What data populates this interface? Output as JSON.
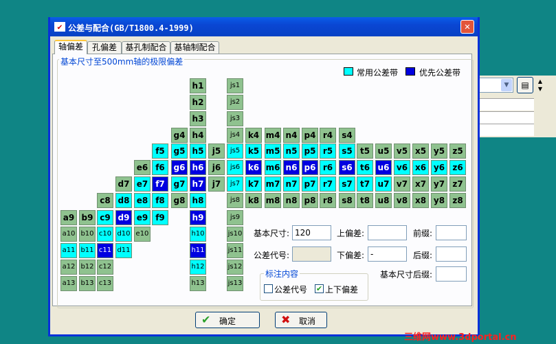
{
  "window": {
    "title": "公差与配合(GB/T1800.4-1999)",
    "close": "✕"
  },
  "tabs": [
    "轴偏差",
    "孔偏差",
    "基孔制配合",
    "基轴制配合"
  ],
  "group_title": "基本尺寸至500mm轴的极限偏差",
  "legend": {
    "common": "常用公差带",
    "preferred": "优先公差带",
    "common_color": "#00ffff",
    "preferred_color": "#0000e0"
  },
  "grid": [
    {
      "c": "a9",
      "s": "g"
    },
    {
      "c": "a10",
      "s": "g"
    },
    {
      "c": "a11",
      "s": "c"
    },
    {
      "c": "a12",
      "s": "g"
    },
    {
      "c": "a13",
      "s": "g"
    },
    {
      "c": "b9",
      "s": "g"
    },
    {
      "c": "b10",
      "s": "g"
    },
    {
      "c": "b11",
      "s": "c"
    },
    {
      "c": "b12",
      "s": "g"
    },
    {
      "c": "b13",
      "s": "g"
    },
    {
      "c": "c8",
      "s": "g"
    },
    {
      "c": "c9",
      "s": "c"
    },
    {
      "c": "c10",
      "s": "c"
    },
    {
      "c": "c11",
      "s": "b"
    },
    {
      "c": "c12",
      "s": "g"
    },
    {
      "c": "c13",
      "s": "g"
    },
    {
      "c": "d7",
      "s": "g"
    },
    {
      "c": "d8",
      "s": "c"
    },
    {
      "c": "d9",
      "s": "b"
    },
    {
      "c": "d10",
      "s": "c"
    },
    {
      "c": "d11",
      "s": "c"
    },
    {
      "c": "e6",
      "s": "g"
    },
    {
      "c": "e7",
      "s": "c"
    },
    {
      "c": "e8",
      "s": "c"
    },
    {
      "c": "e9",
      "s": "c"
    },
    {
      "c": "e10",
      "s": "g"
    },
    {
      "c": "f5",
      "s": "c"
    },
    {
      "c": "f6",
      "s": "c"
    },
    {
      "c": "f7",
      "s": "b"
    },
    {
      "c": "f8",
      "s": "c"
    },
    {
      "c": "f9",
      "s": "c"
    },
    {
      "c": "g4",
      "s": "g"
    },
    {
      "c": "g5",
      "s": "c"
    },
    {
      "c": "g6",
      "s": "b"
    },
    {
      "c": "g7",
      "s": "c"
    },
    {
      "c": "g8",
      "s": "g"
    },
    {
      "c": "h1",
      "s": "g"
    },
    {
      "c": "h2",
      "s": "g"
    },
    {
      "c": "h3",
      "s": "g"
    },
    {
      "c": "h4",
      "s": "g"
    },
    {
      "c": "h5",
      "s": "c"
    },
    {
      "c": "h6",
      "s": "b"
    },
    {
      "c": "h7",
      "s": "b"
    },
    {
      "c": "h8",
      "s": "c"
    },
    {
      "c": "h9",
      "s": "b"
    },
    {
      "c": "h10",
      "s": "c"
    },
    {
      "c": "h11",
      "s": "b"
    },
    {
      "c": "h12",
      "s": "c"
    },
    {
      "c": "h13",
      "s": "g"
    },
    {
      "c": "j5",
      "s": "g"
    },
    {
      "c": "j6",
      "s": "g"
    },
    {
      "c": "j7",
      "s": "g"
    },
    {
      "c": "js1",
      "s": "g"
    },
    {
      "c": "js2",
      "s": "g"
    },
    {
      "c": "js3",
      "s": "g"
    },
    {
      "c": "js4",
      "s": "g"
    },
    {
      "c": "js5",
      "s": "c"
    },
    {
      "c": "js6",
      "s": "c"
    },
    {
      "c": "js7",
      "s": "c"
    },
    {
      "c": "js8",
      "s": "g"
    },
    {
      "c": "js9",
      "s": "g"
    },
    {
      "c": "js10",
      "s": "g"
    },
    {
      "c": "js11",
      "s": "g"
    },
    {
      "c": "js12",
      "s": "g"
    },
    {
      "c": "js13",
      "s": "g"
    },
    {
      "c": "k4",
      "s": "g"
    },
    {
      "c": "k5",
      "s": "c"
    },
    {
      "c": "k6",
      "s": "b"
    },
    {
      "c": "k7",
      "s": "c"
    },
    {
      "c": "k8",
      "s": "g"
    },
    {
      "c": "m4",
      "s": "g"
    },
    {
      "c": "m5",
      "s": "c"
    },
    {
      "c": "m6",
      "s": "c"
    },
    {
      "c": "m7",
      "s": "c"
    },
    {
      "c": "m8",
      "s": "g"
    },
    {
      "c": "n4",
      "s": "g"
    },
    {
      "c": "n5",
      "s": "c"
    },
    {
      "c": "n6",
      "s": "b"
    },
    {
      "c": "n7",
      "s": "c"
    },
    {
      "c": "n8",
      "s": "g"
    },
    {
      "c": "p4",
      "s": "g"
    },
    {
      "c": "p5",
      "s": "c"
    },
    {
      "c": "p6",
      "s": "b"
    },
    {
      "c": "p7",
      "s": "c"
    },
    {
      "c": "p8",
      "s": "g"
    },
    {
      "c": "r4",
      "s": "g"
    },
    {
      "c": "r5",
      "s": "c"
    },
    {
      "c": "r6",
      "s": "c"
    },
    {
      "c": "r7",
      "s": "c"
    },
    {
      "c": "r8",
      "s": "g"
    },
    {
      "c": "s4",
      "s": "g"
    },
    {
      "c": "s5",
      "s": "c"
    },
    {
      "c": "s6",
      "s": "b"
    },
    {
      "c": "s7",
      "s": "c"
    },
    {
      "c": "s8",
      "s": "g"
    },
    {
      "c": "t5",
      "s": "g"
    },
    {
      "c": "t6",
      "s": "c"
    },
    {
      "c": "t7",
      "s": "c"
    },
    {
      "c": "t8",
      "s": "g"
    },
    {
      "c": "u5",
      "s": "g"
    },
    {
      "c": "u6",
      "s": "b"
    },
    {
      "c": "u7",
      "s": "c"
    },
    {
      "c": "u8",
      "s": "g"
    },
    {
      "c": "v5",
      "s": "g"
    },
    {
      "c": "v6",
      "s": "c"
    },
    {
      "c": "v7",
      "s": "g"
    },
    {
      "c": "v8",
      "s": "g"
    },
    {
      "c": "x5",
      "s": "g"
    },
    {
      "c": "x6",
      "s": "c"
    },
    {
      "c": "x7",
      "s": "g"
    },
    {
      "c": "x8",
      "s": "g"
    },
    {
      "c": "y5",
      "s": "g"
    },
    {
      "c": "y6",
      "s": "c"
    },
    {
      "c": "y7",
      "s": "g"
    },
    {
      "c": "y8",
      "s": "g"
    },
    {
      "c": "z5",
      "s": "g"
    },
    {
      "c": "z6",
      "s": "c"
    },
    {
      "c": "z7",
      "s": "g"
    },
    {
      "c": "z8",
      "s": "g"
    }
  ],
  "form": {
    "basic_size_label": "基本尺寸:",
    "basic_size_value": "120",
    "upper_dev_label": "上偏差:",
    "upper_dev_value": "",
    "prefix_label": "前缀:",
    "prefix_value": "",
    "code_label": "公差代号:",
    "code_value": "",
    "lower_dev_label": "下偏差:",
    "lower_dev_value": "-",
    "suffix_label": "后缀:",
    "suffix_value": "",
    "size_suffix_label": "基本尺寸后缀:",
    "size_suffix_value": "",
    "annot_title": "标注内容",
    "chk_code_label": "公差代号",
    "chk_code_checked": false,
    "chk_dev_label": "上下偏差",
    "chk_dev_checked": true
  },
  "buttons": {
    "ok": "确定",
    "cancel": "取消"
  },
  "watermark": "三维网www.3dportal.cn"
}
